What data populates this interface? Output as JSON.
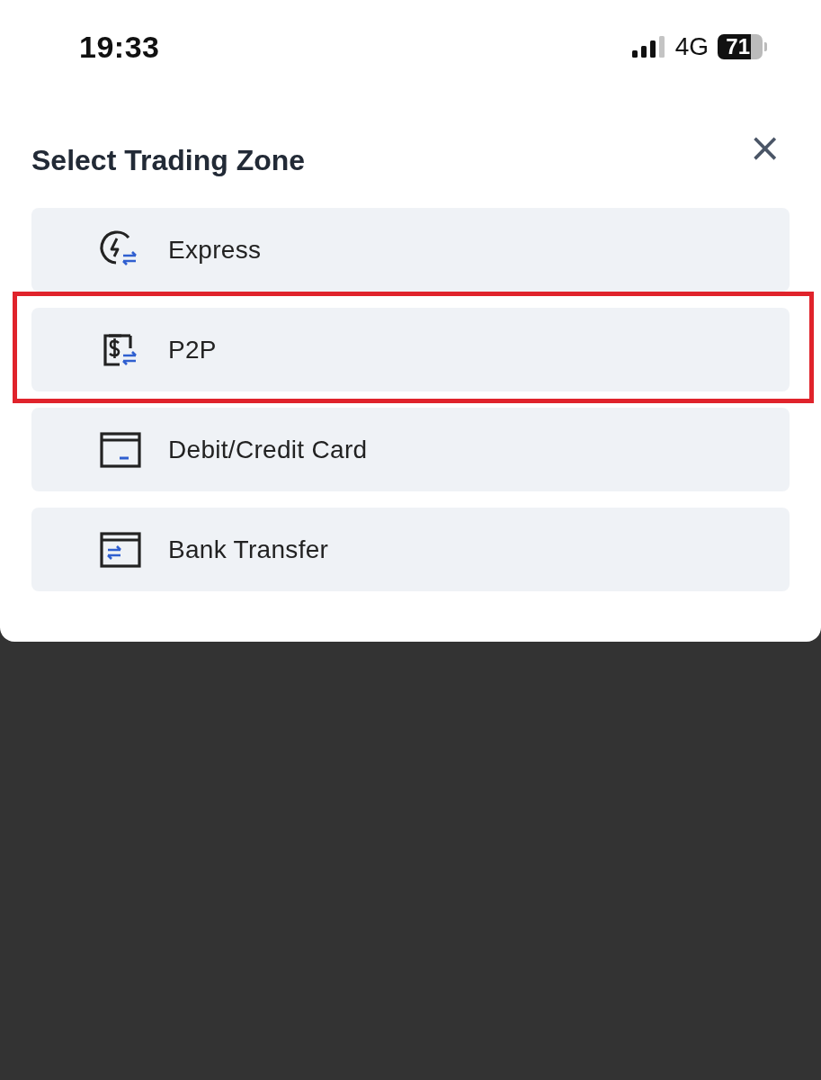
{
  "status_bar": {
    "time": "19:33",
    "network": "4G",
    "battery": "71"
  },
  "sheet": {
    "title": "Select Trading Zone",
    "close": "×",
    "items": [
      {
        "kind": "express",
        "label": "Express",
        "highlighted": false
      },
      {
        "kind": "p2p",
        "label": "P2P",
        "highlighted": true
      },
      {
        "kind": "card",
        "label": "Debit/Credit Card",
        "highlighted": false
      },
      {
        "kind": "bank",
        "label": "Bank Transfer",
        "highlighted": false
      }
    ]
  }
}
